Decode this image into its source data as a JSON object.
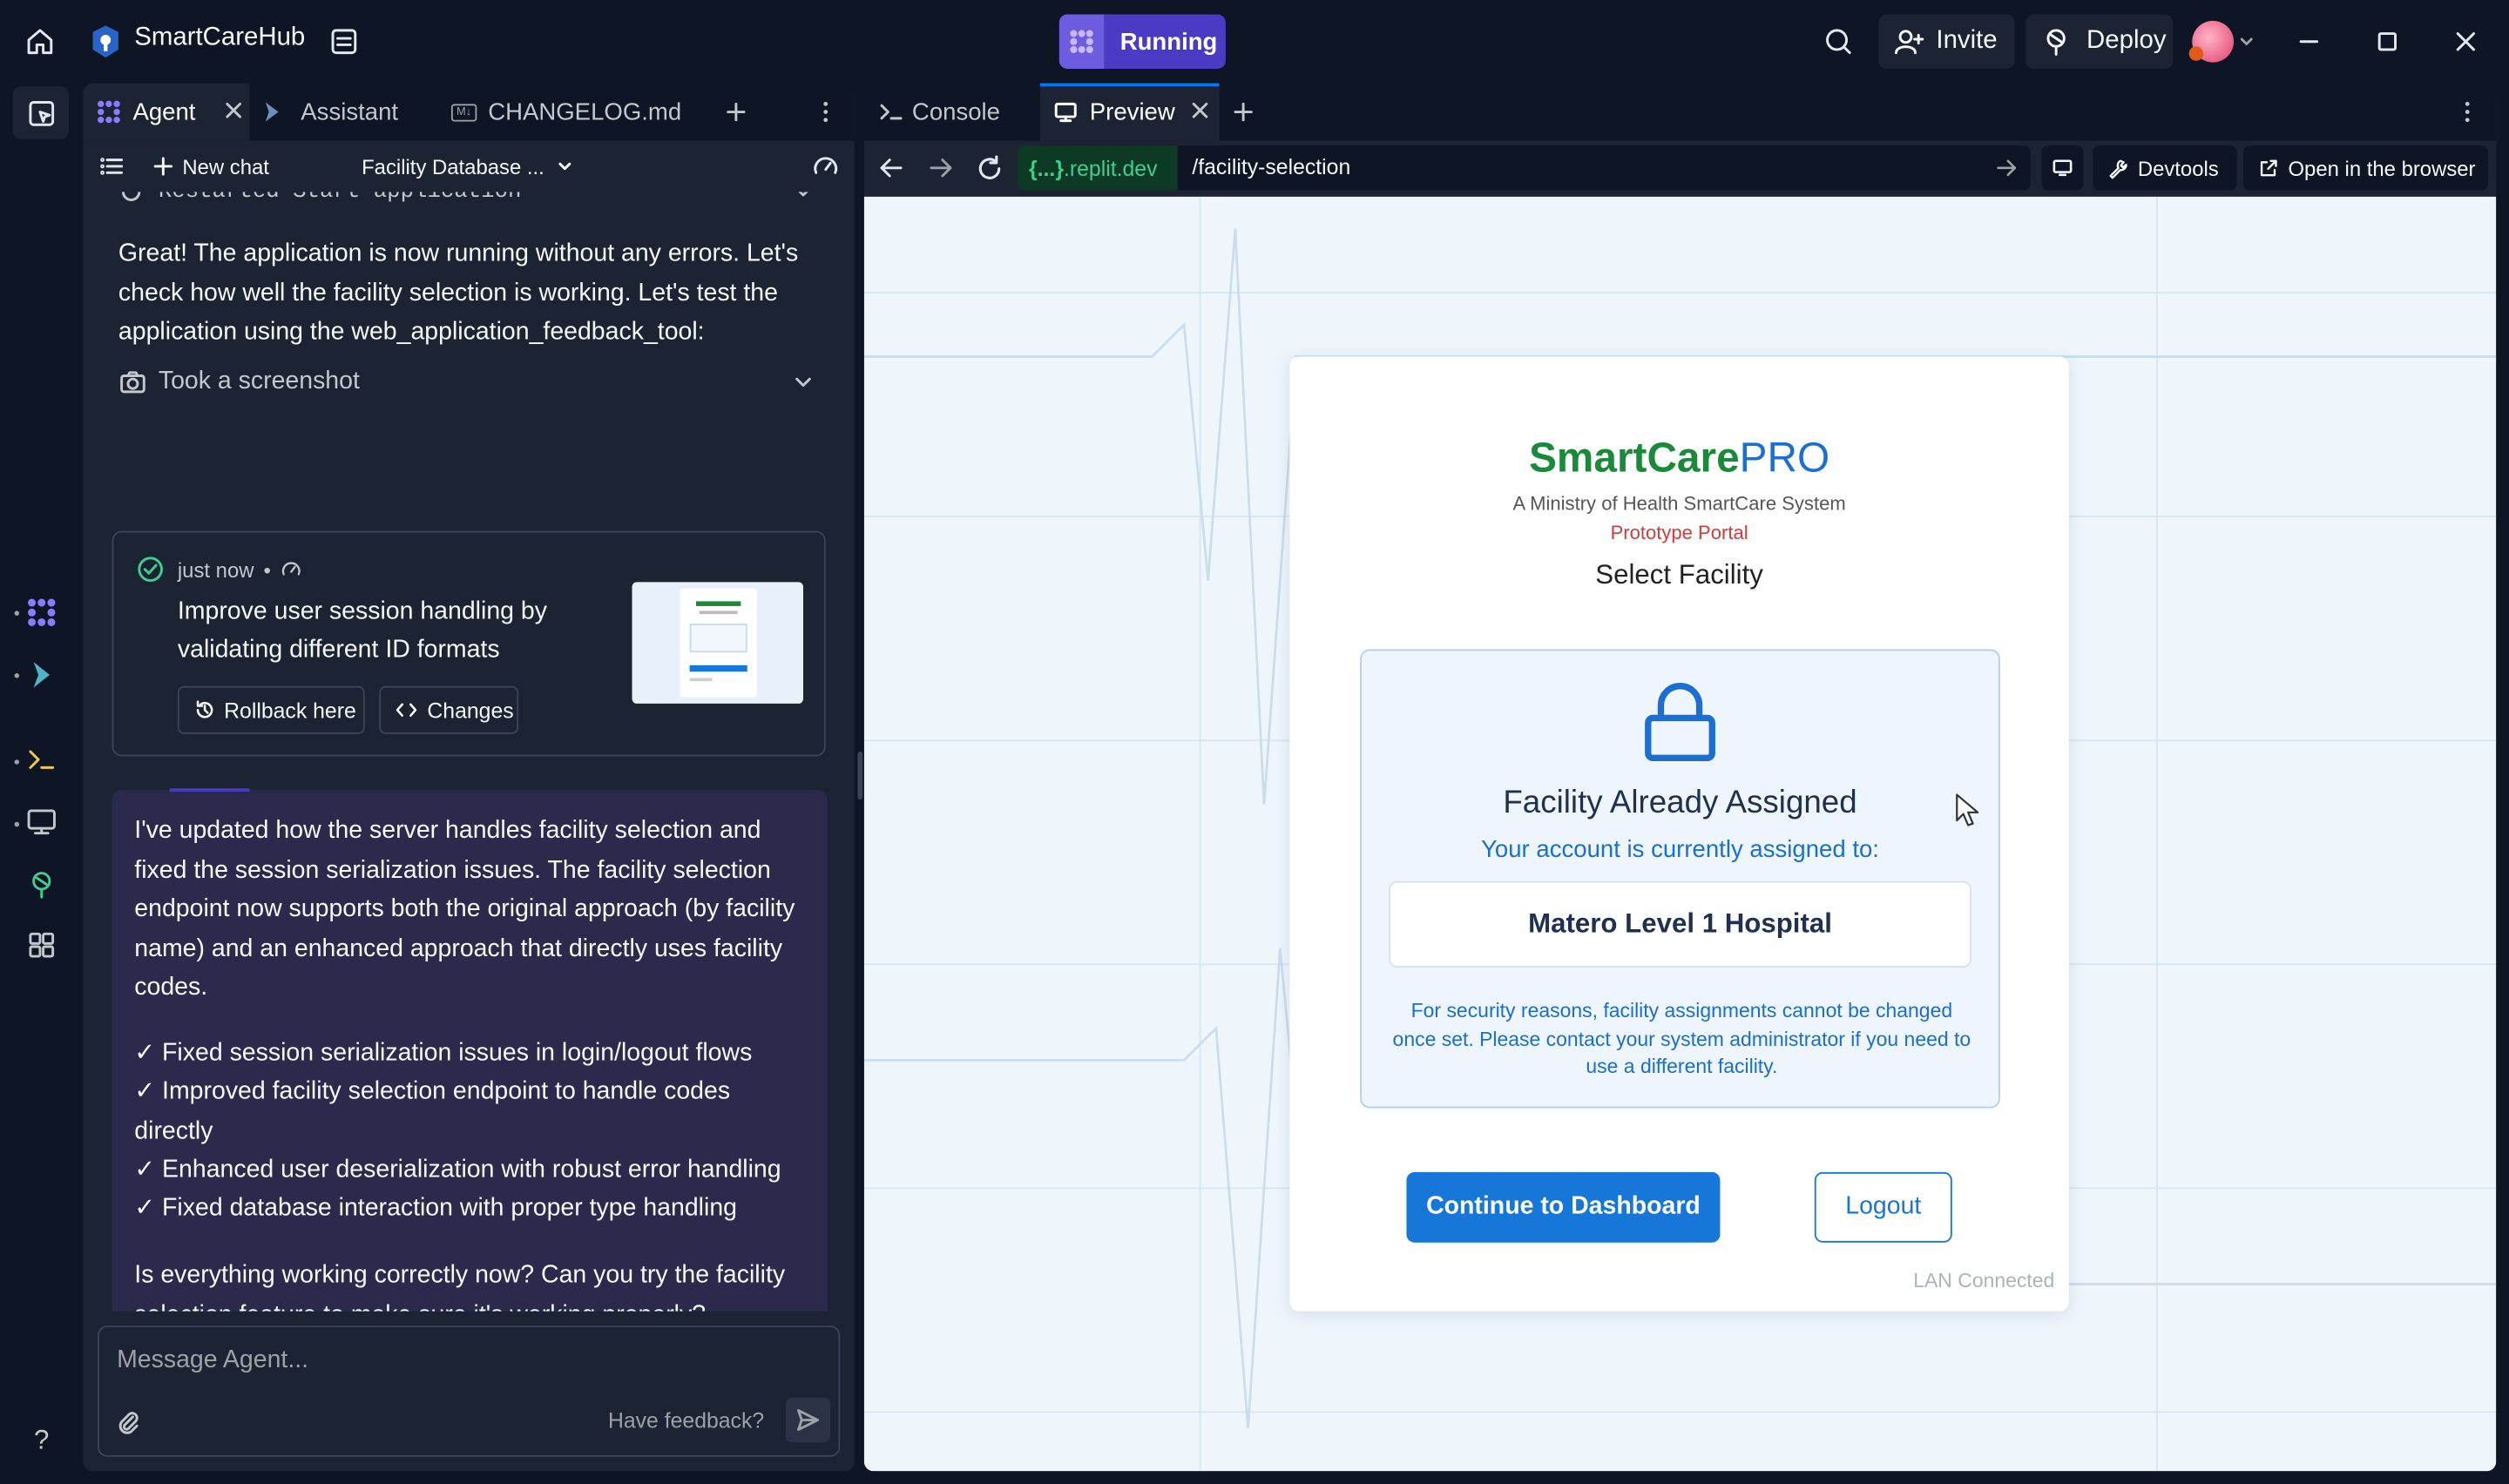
{
  "topbar": {
    "project_name": "SmartCareHub",
    "run_label": "Running",
    "invite_label": "Invite",
    "deploy_label": "Deploy"
  },
  "left_tabs": [
    {
      "label": "Agent",
      "icon": "agent-icon"
    },
    {
      "label": "Assistant",
      "icon": "assistant-icon"
    },
    {
      "label": "CHANGELOG.md",
      "icon": "markdown-icon"
    }
  ],
  "agent": {
    "new_chat_label": "New chat",
    "chat_title": "Facility Database ...",
    "restarted_text": "Restarted Start application",
    "intro_text": "Great! The application is now running without any errors. Let's check how well the facility selection is working. Let's test the application using the web_application_feedback_tool:",
    "screenshot_label": "Took a screenshot",
    "checkpoint": {
      "time": "just now",
      "title": "Improve user session handling by validating different ID formats",
      "rollback_label": "Rollback here",
      "changes_label": "Changes"
    },
    "message": {
      "intro": "I've updated how the server handles facility selection and fixed the session serialization issues. The facility selection endpoint now supports both the original approach (by facility name) and an enhanced approach that directly uses facility codes.",
      "items": [
        "✓ Fixed session serialization issues in login/logout flows",
        "✓ Improved facility selection endpoint to handle codes directly",
        "✓ Enhanced user deserialization with robust error handling",
        "✓ Fixed database interaction with proper type handling"
      ],
      "question": "Is everything working correctly now? Can you try the facility selection feature to make sure it's working properly?"
    },
    "input_placeholder": "Message Agent...",
    "feedback_label": "Have feedback?"
  },
  "right_tabs": [
    {
      "label": "Console",
      "icon": "terminal-icon"
    },
    {
      "label": "Preview",
      "icon": "monitor-icon"
    }
  ],
  "url": {
    "domain_prefix": "{...}",
    "domain": ".replit.dev",
    "path": "/facility-selection"
  },
  "devtools_label": "Devtools",
  "open_browser_label": "Open in the browser",
  "preview": {
    "brand_smart": "SmartCare",
    "brand_pro": "PRO",
    "subtitle": "A Ministry of Health SmartCare System",
    "portal_label": "Prototype Portal",
    "heading": "Select Facility",
    "assigned_title": "Facility Already Assigned",
    "assigned_sub": "Your account is currently assigned to:",
    "facility_name": "Matero Level 1 Hospital",
    "security_note": "For security reasons, facility assignments cannot be changed once set. Please contact your system administrator if you need to use a different facility.",
    "continue_label": "Continue to Dashboard",
    "logout_label": "Logout",
    "status_label": "LAN Connected"
  },
  "colors": {
    "run_purple": "#4b3bc4",
    "brand_green": "#1a8a3a",
    "brand_blue": "#1a6fd1",
    "portal_red": "#d43a3a",
    "primary_button": "#1677d9"
  }
}
